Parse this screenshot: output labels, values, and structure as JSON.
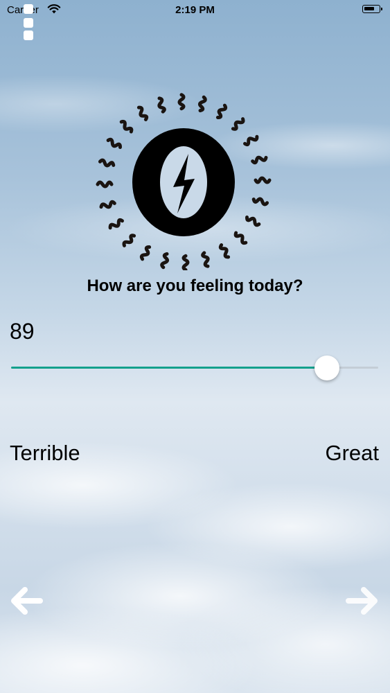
{
  "status_bar": {
    "carrier": "Carrier",
    "time": "2:19 PM",
    "icons": [
      "wifi-icon",
      "battery-icon"
    ]
  },
  "menu": {
    "icon": "vertical-dots-icon"
  },
  "mood_icon": {
    "icon": "spinning-sun-face-icon"
  },
  "question": "How are you feeling today?",
  "slider": {
    "value": "89",
    "min_label": "Terrible",
    "max_label": "Great",
    "fill_fraction": 0.86,
    "accent_color": "#13a08c"
  },
  "navigation": {
    "back_icon": "arrow-left-icon",
    "forward_icon": "arrow-right-icon"
  }
}
